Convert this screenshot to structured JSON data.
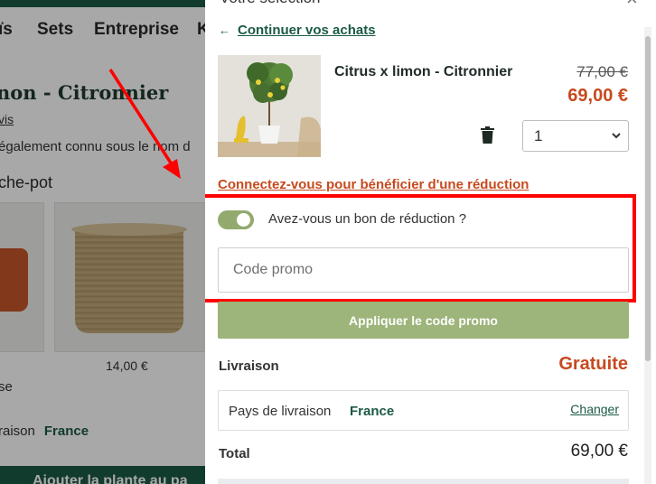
{
  "background_page": {
    "nav_items": [
      "ïs",
      "Sets",
      "Entreprise",
      "K"
    ],
    "product_title": "non - Citronnier",
    "reviews_link": "vis",
    "description": "également connu sous le nom d",
    "section_title": "che-pot",
    "card_price": "14,00 €",
    "partial_text": "se",
    "delivery_label": "raison",
    "delivery_country": "France",
    "cta_label": "Ajouter la plante au pa"
  },
  "cart": {
    "title": "Votre sélection",
    "close_icon": "close-icon",
    "continue_shopping": "Continuer vos achats",
    "back_arrow": "←",
    "item": {
      "name": "Citrus x limon - Citronnier",
      "old_price": "77,00 €",
      "price": "69,00 €",
      "quantity": "1"
    },
    "login_discount": "Connectez-vous pour bénéficier d'une réduction",
    "promo_toggle_label": "Avez-vous un bon de réduction ?",
    "promo_toggle_on": true,
    "promo_placeholder": "Code promo",
    "apply_button": "Appliquer le code promo",
    "shipping_label": "Livraison",
    "shipping_value": "Gratuite",
    "country_label": "Pays de livraison",
    "country_value": "France",
    "change_link": "Changer",
    "total_label": "Total",
    "total_value": "69,00 €"
  },
  "colors": {
    "brand_green": "#1b5a43",
    "accent_orange": "#c64a1f",
    "button_green": "#9db47a",
    "annotation_red": "#ff0000"
  }
}
